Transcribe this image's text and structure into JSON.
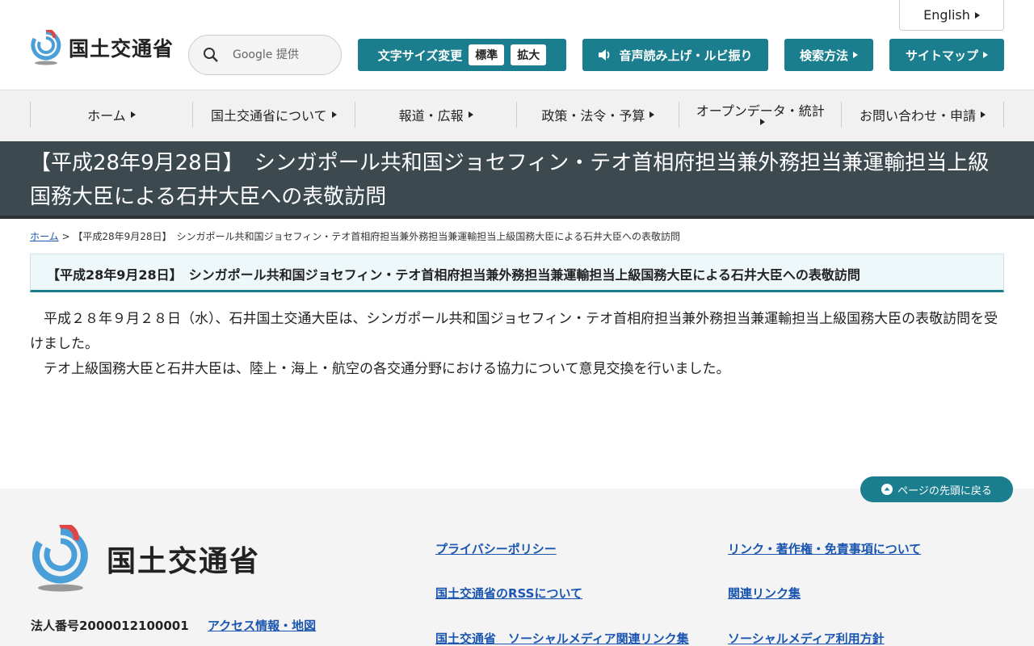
{
  "header": {
    "logo_text": "国土交通省",
    "search": {
      "placeholder": "Google 提供"
    },
    "english_label": "English",
    "font_size": {
      "label": "文字サイズ変更",
      "standard": "標準",
      "large": "拡大"
    },
    "voice_label": "音声読み上げ・ルビ振り",
    "search_method_label": "検索方法",
    "sitemap_label": "サイトマップ"
  },
  "nav": [
    {
      "label": "ホーム"
    },
    {
      "label": "国土交通省について"
    },
    {
      "label": "報道・広報"
    },
    {
      "label": "政策・法令・予算"
    },
    {
      "label": "オープンデータ・統計"
    },
    {
      "label": "お問い合わせ・申請"
    }
  ],
  "page": {
    "title": "【平成28年9月28日】　シンガポール共和国ジョセフィン・テオ首相府担当兼外務担当兼運輸担当上級国務大臣による石井大臣への表敬訪問",
    "breadcrumb": {
      "home": "ホーム",
      "separator": ">",
      "current": "【平成28年9月28日】　シンガポール共和国ジョセフィン・テオ首相府担当兼外務担当兼運輸担当上級国務大臣による石井大臣への表敬訪問"
    },
    "heading": "【平成28年9月28日】　シンガポール共和国ジョセフィン・テオ首相府担当兼外務担当兼運輸担当上級国務大臣による石井大臣への表敬訪問",
    "paragraphs": [
      "平成２８年９月２８日（水）、石井国土交通大臣は、シンガポール共和国ジョセフィン・テオ首相府担当兼外務担当兼運輸担当上級国務大臣の表敬訪問を受けました。",
      "テオ上級国務大臣と石井大臣は、陸上・海上・航空の各交通分野における協力について意見交換を行いました。"
    ]
  },
  "footer": {
    "pagetop_label": "ページの先頭に戻る",
    "logo_text": "国土交通省",
    "corp_number": "法人番号2000012100001",
    "access_label": "アクセス情報・地図",
    "links": [
      {
        "label": "プライバシーポリシー"
      },
      {
        "label": "リンク・著作権・免責事項について"
      },
      {
        "label": "国土交通省のRSSについて"
      },
      {
        "label": "関連リンク集"
      },
      {
        "label": "国土交通省　ソーシャルメディア関連リンク集"
      },
      {
        "label": "ソーシャルメディア利用方針"
      }
    ]
  },
  "colors": {
    "accent": "#1a7e8e",
    "title_band": "#3c4a50",
    "link": "#1a55b0"
  }
}
